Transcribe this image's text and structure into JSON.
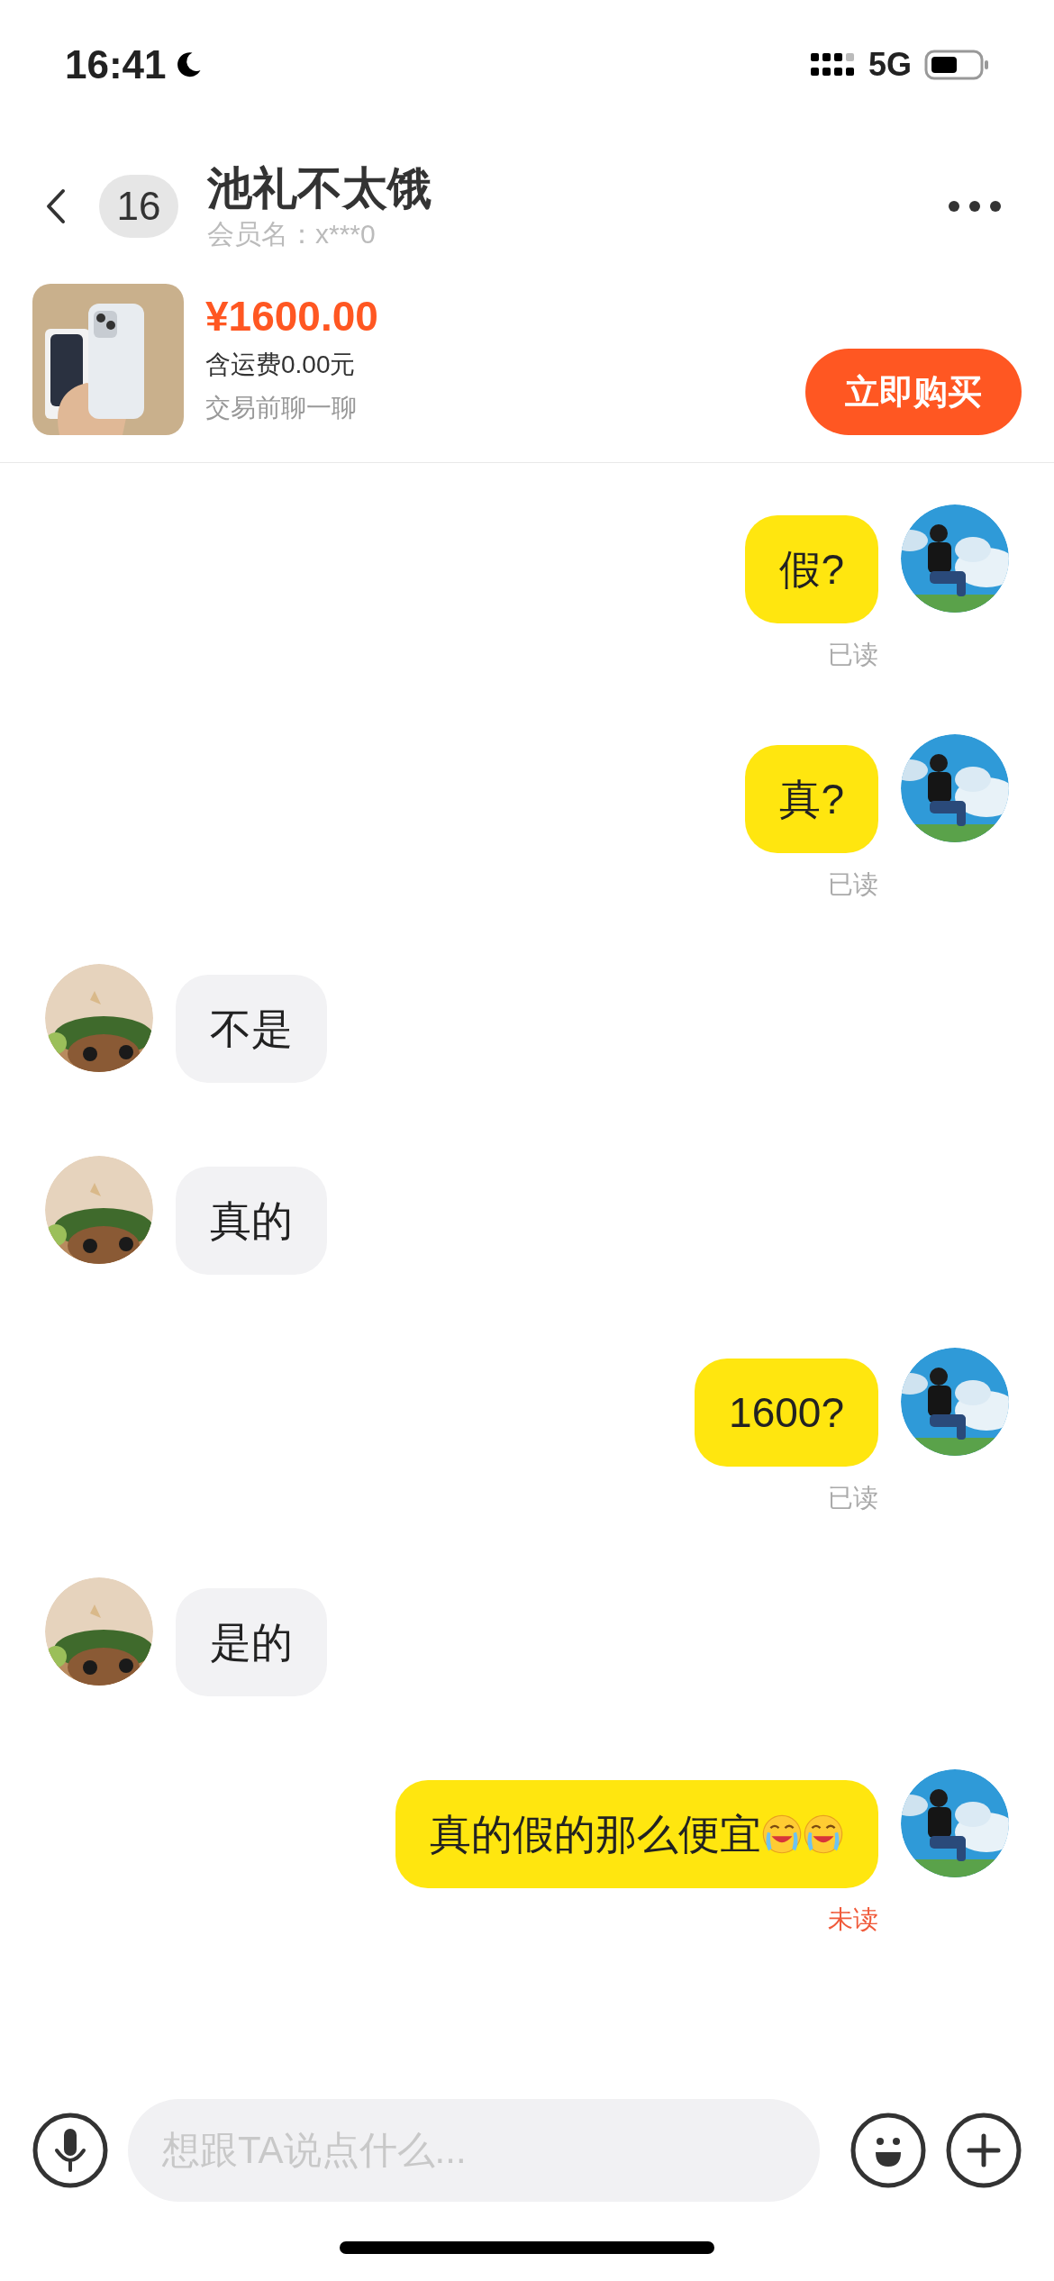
{
  "status_bar": {
    "time": "16:41",
    "network": "5G"
  },
  "header": {
    "unread_count": "16",
    "title": "池礼不太饿",
    "subtitle": "会员名：x***0"
  },
  "product": {
    "price": "¥1600.00",
    "shipping": "含运费0.00元",
    "note": "交易前聊一聊",
    "buy_button": "立即购买"
  },
  "messages": [
    {
      "kind": "outgoing",
      "text": "假?",
      "receipt": {
        "text": "已读",
        "unread": false
      }
    },
    {
      "kind": "outgoing",
      "text": "真?",
      "receipt": {
        "text": "已读",
        "unread": false
      }
    },
    {
      "kind": "incoming",
      "text": "不是"
    },
    {
      "kind": "incoming",
      "text": "真的"
    },
    {
      "kind": "outgoing",
      "text": "1600?",
      "receipt": {
        "text": "已读",
        "unread": false
      }
    },
    {
      "kind": "incoming",
      "text": "是的"
    },
    {
      "kind": "outgoing",
      "text": "真的假的那么便宜",
      "emojis": [
        {
          "kind": "laughing-crying"
        },
        {
          "kind": "laughing-crying"
        }
      ],
      "receipt": {
        "text": "未读",
        "unread": true
      }
    }
  ],
  "input": {
    "placeholder": "想跟TA说点什么..."
  }
}
